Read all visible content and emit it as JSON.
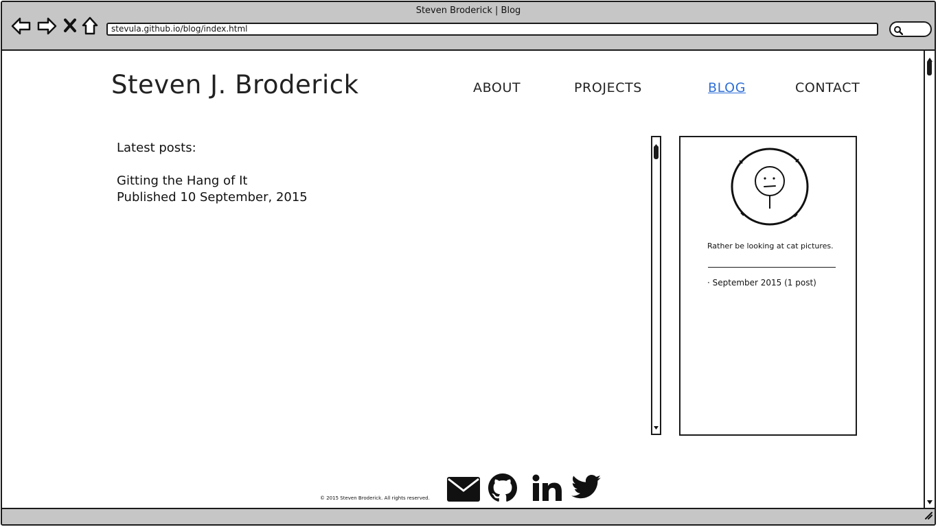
{
  "window": {
    "title": "Steven Broderick | Blog"
  },
  "address_bar": {
    "url": "stevula.github.io/blog/index.html"
  },
  "site": {
    "title": "Steven J. Broderick"
  },
  "nav": {
    "items": [
      {
        "label": "ABOUT",
        "active": false
      },
      {
        "label": "PROJECTS",
        "active": false
      },
      {
        "label": "BLOG",
        "active": true
      },
      {
        "label": "CONTACT",
        "active": false
      }
    ],
    "active_color": "#2f6fd6"
  },
  "main": {
    "heading": "Latest posts:",
    "posts": [
      {
        "title": "Gitting the Hang of It",
        "published": "Published 10 September, 2015"
      }
    ]
  },
  "sidebar": {
    "avatar": "avatar-sketch-face",
    "tagline": "Rather be looking at cat pictures.",
    "archive": [
      "· September 2015 (1 post)"
    ]
  },
  "footer": {
    "copyright": "© 2015 Steven Broderick. All rights reserved.",
    "social_icons": [
      "email-icon",
      "github-icon",
      "linkedin-icon",
      "twitter-icon"
    ]
  },
  "icons": {
    "back": "back-arrow-icon",
    "forward": "forward-arrow-icon",
    "stop": "stop-x-icon",
    "home": "home-icon",
    "search": "search-icon"
  }
}
